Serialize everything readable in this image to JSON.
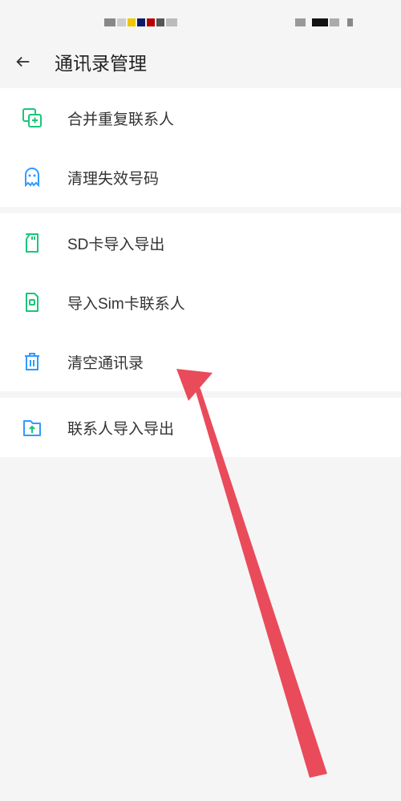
{
  "header": {
    "title": "通讯录管理"
  },
  "sections": [
    {
      "items": [
        {
          "icon": "merge-contacts-icon",
          "label": "合并重复联系人"
        },
        {
          "icon": "ghost-icon",
          "label": "清理失效号码"
        }
      ]
    },
    {
      "items": [
        {
          "icon": "sd-card-icon",
          "label": "SD卡导入导出"
        },
        {
          "icon": "sim-card-icon",
          "label": "导入Sim卡联系人"
        },
        {
          "icon": "trash-icon",
          "label": "清空通讯录"
        }
      ]
    },
    {
      "items": [
        {
          "icon": "import-export-icon",
          "label": "联系人导入导出"
        }
      ]
    }
  ],
  "annotation": {
    "type": "arrow",
    "color": "#E94B5B",
    "target": "清空通讯录"
  }
}
